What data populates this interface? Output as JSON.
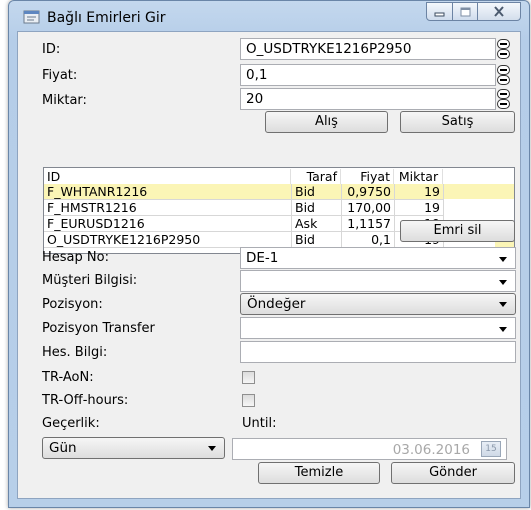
{
  "window": {
    "title": "Bağlı Emirleri Gir"
  },
  "form": {
    "id_label": "ID:",
    "id_value": "O_USDTRYKE1216P2950",
    "fiyat_label": "Fiyat:",
    "fiyat_value": "0,1",
    "miktar_label": "Miktar:",
    "miktar_value": "20"
  },
  "buttons": {
    "alis": "Alış",
    "satis": "Satış",
    "emri_sil": "Emri sil",
    "temizle": "Temizle",
    "gonder": "Gönder"
  },
  "orders_table": {
    "headers": [
      "ID",
      "Taraf",
      "Fiyat",
      "Miktar"
    ],
    "rows": [
      {
        "id": "F_WHTANR1216",
        "taraf": "Bid",
        "fiyat": "0,9750",
        "miktar": "19",
        "selected": true
      },
      {
        "id": "F_HMSTR1216",
        "taraf": "Bid",
        "fiyat": "170,00",
        "miktar": "19",
        "selected": false
      },
      {
        "id": "F_EURUSD1216",
        "taraf": "Ask",
        "fiyat": "1,1157",
        "miktar": "19",
        "selected": false
      },
      {
        "id": "O_USDTRYKE1216P2950",
        "taraf": "Bid",
        "fiyat": "0,1",
        "miktar": "19",
        "selected": false
      }
    ]
  },
  "account": {
    "hesap_no_label": "Hesap No:",
    "hesap_no_value": "DE-1",
    "musteri_label": "Müşteri Bilgisi:",
    "musteri_value": "",
    "pozisyon_label": "Pozisyon:",
    "pozisyon_value": "Öndeğer",
    "transfer_label": "Pozisyon Transfer",
    "transfer_value": "",
    "hes_bilgi_label": "Hes. Bilgi:",
    "hes_bilgi_value": "",
    "tr_aon_label": "TR-AoN:",
    "tr_aon_checked": false,
    "tr_offhours_label": "TR-Off-hours:",
    "tr_offhours_checked": false
  },
  "validity": {
    "gecerlik_label": "Geçerlik:",
    "until_label": "Until:",
    "gecerlik_value": "Gün",
    "until_date": "03.06.2016",
    "calendar_day": "15"
  }
}
